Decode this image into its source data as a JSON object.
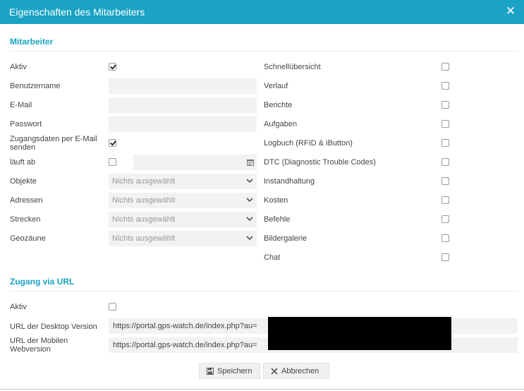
{
  "window": {
    "title": "Eigenschaften des Mitarbeiters",
    "close_label": "✕"
  },
  "section_employee": {
    "title": "Mitarbeiter",
    "active_label": "Aktiv",
    "active_checked": true,
    "username_label": "Benutzername",
    "username_value": "",
    "email_label": "E-Mail",
    "email_value": "",
    "password_label": "Passwort",
    "password_value": "",
    "send_credentials_label_line1": "Zugangsdaten per E-Mail",
    "send_credentials_label_line2": "senden",
    "send_credentials_checked": true,
    "expires_label": "läuft ab",
    "expires_checked": false,
    "expires_value": "",
    "selects": [
      {
        "label": "Objekte",
        "value": "Nichts ausgewählt"
      },
      {
        "label": "Adressen",
        "value": "Nichts ausgewählt"
      },
      {
        "label": "Strecken",
        "value": "Nichts ausgewählt"
      },
      {
        "label": "Geozäune",
        "value": "Nichts ausgewählt"
      }
    ]
  },
  "permissions": [
    {
      "label": "Schnellübersicht",
      "checked": false
    },
    {
      "label": "Verlauf",
      "checked": false
    },
    {
      "label": "Berichte",
      "checked": false
    },
    {
      "label": "Aufgaben",
      "checked": false
    },
    {
      "label": "Logbuch (RFID & iButton)",
      "checked": false
    },
    {
      "label": "DTC (Diagnostic Trouble Codes)",
      "checked": false
    },
    {
      "label": "Instandhaltung",
      "checked": false
    },
    {
      "label": "Kosten",
      "checked": false
    },
    {
      "label": "Befehle",
      "checked": false
    },
    {
      "label": "Bildergalerie",
      "checked": false
    },
    {
      "label": "Chat",
      "checked": false
    }
  ],
  "section_url": {
    "title": "Zugang via URL",
    "active_label": "Aktiv",
    "active_checked": false,
    "desktop_label": "URL der Desktop Version",
    "desktop_value": "https://portal.gps-watch.de/index.php?au=",
    "mobile_label_line1": "URL der Mobilen",
    "mobile_label_line2": "Webversion",
    "mobile_value": "https://portal.gps-watch.de/index.php?au="
  },
  "buttons": {
    "save_label": "Speichern",
    "cancel_label": "Abbrechen"
  },
  "colors": {
    "accent": "#1aa3c4",
    "field_bg": "#f2f2f2"
  }
}
